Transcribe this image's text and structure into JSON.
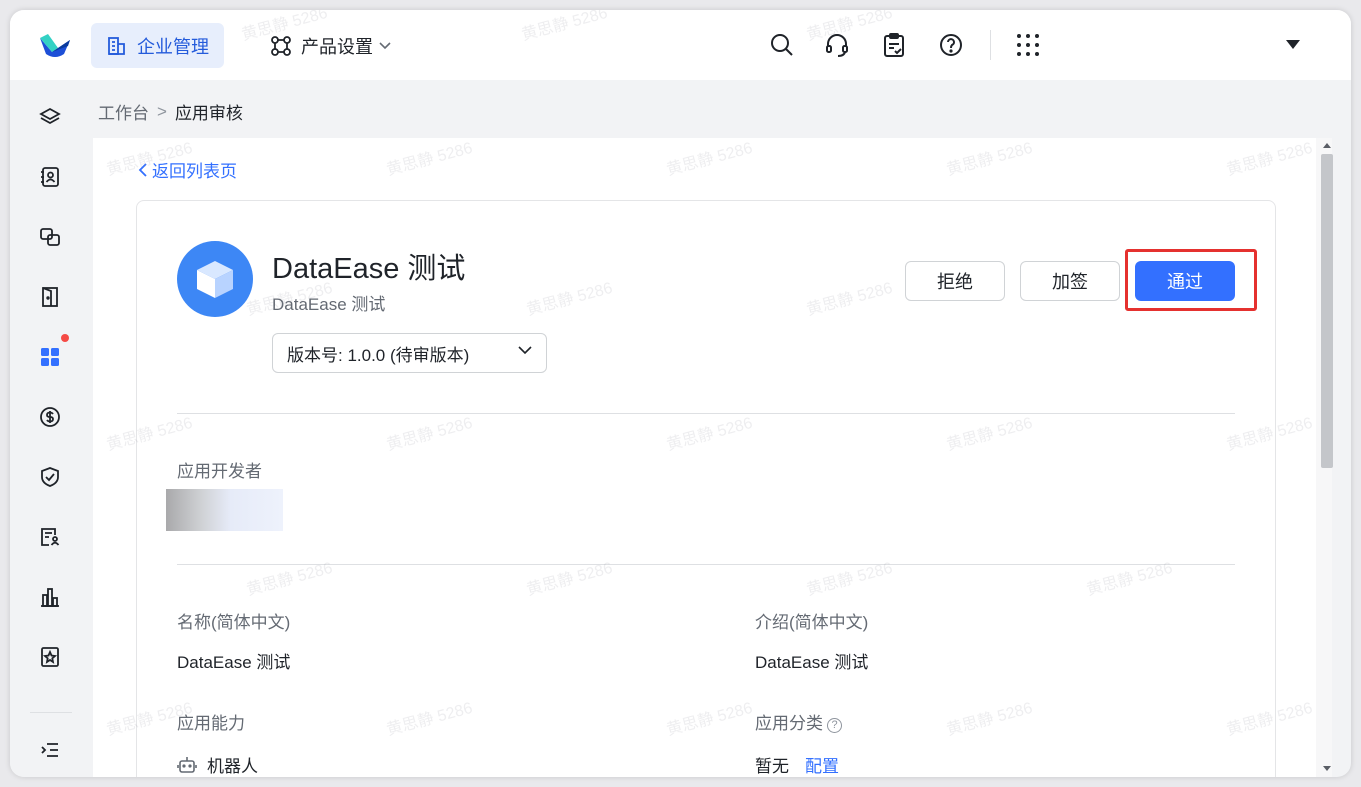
{
  "topbar": {
    "nav_enterprise": "企业管理",
    "nav_product": "产品设置"
  },
  "breadcrumb": {
    "root": "工作台",
    "separator": ">",
    "current": "应用审核"
  },
  "back_link": "返回列表页",
  "app": {
    "title": "DataEase 测试",
    "subtitle": "DataEase 测试",
    "version_select": "版本号: 1.0.0 (待审版本)"
  },
  "actions": {
    "reject": "拒绝",
    "cosign": "加签",
    "approve": "通过"
  },
  "details": {
    "developer_label": "应用开发者",
    "name_label": "名称(简体中文)",
    "name_value": "DataEase 测试",
    "intro_label": "介绍(简体中文)",
    "intro_value": "DataEase 测试",
    "capability_label": "应用能力",
    "capability_value": "机器人",
    "category_label": "应用分类",
    "category_help": "?",
    "category_value": "暂无",
    "category_config": "配置"
  },
  "watermark_text": "黄思静 5286",
  "colors": {
    "accent": "#3370ff",
    "highlight": "#e5312f",
    "nav_active_bg": "#e7eefc",
    "notification_dot": "#f54a45"
  },
  "icons": {
    "topbar": [
      "search-icon",
      "headset-icon",
      "clipboard-icon",
      "help-icon",
      "apps-grid-icon"
    ],
    "sidebar": [
      "layers-icon",
      "contacts-icon",
      "link-icon",
      "door-icon",
      "apps-icon",
      "dollar-icon",
      "shield-icon",
      "form-user-icon",
      "bar-chart-icon",
      "star-doc-icon",
      "collapse-icon"
    ]
  }
}
